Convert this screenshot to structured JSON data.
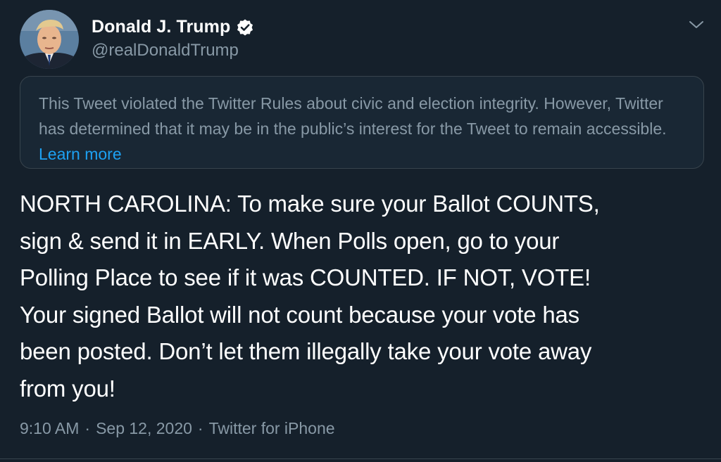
{
  "user": {
    "display_name": "Donald J. Trump",
    "handle": "@realDonaldTrump",
    "verified": true,
    "verified_icon": "verified-badge-icon"
  },
  "notice": {
    "text": "This Tweet violated the Twitter Rules about civic and election integrity. However, Twitter has determined that it may be in the public’s interest for the Tweet to remain accessible.",
    "link": "Learn more"
  },
  "tweet": {
    "text": "NORTH CAROLINA: To make sure your Ballot COUNTS,\nsign & send it in EARLY. When Polls open, go to your\nPolling Place to see if it was COUNTED. IF NOT, VOTE!\nYour signed Ballot will not count because your vote has\nbeen posted. Don’t let them illegally take your vote away\nfrom you!"
  },
  "meta": {
    "time": "9:10 AM",
    "separator": "·",
    "date": "Sep 12, 2020",
    "source": "Twitter for iPhone"
  },
  "colors": {
    "background": "#15202b",
    "secondary_text": "#8899a6",
    "link": "#1da1f2",
    "border": "#38444d"
  }
}
